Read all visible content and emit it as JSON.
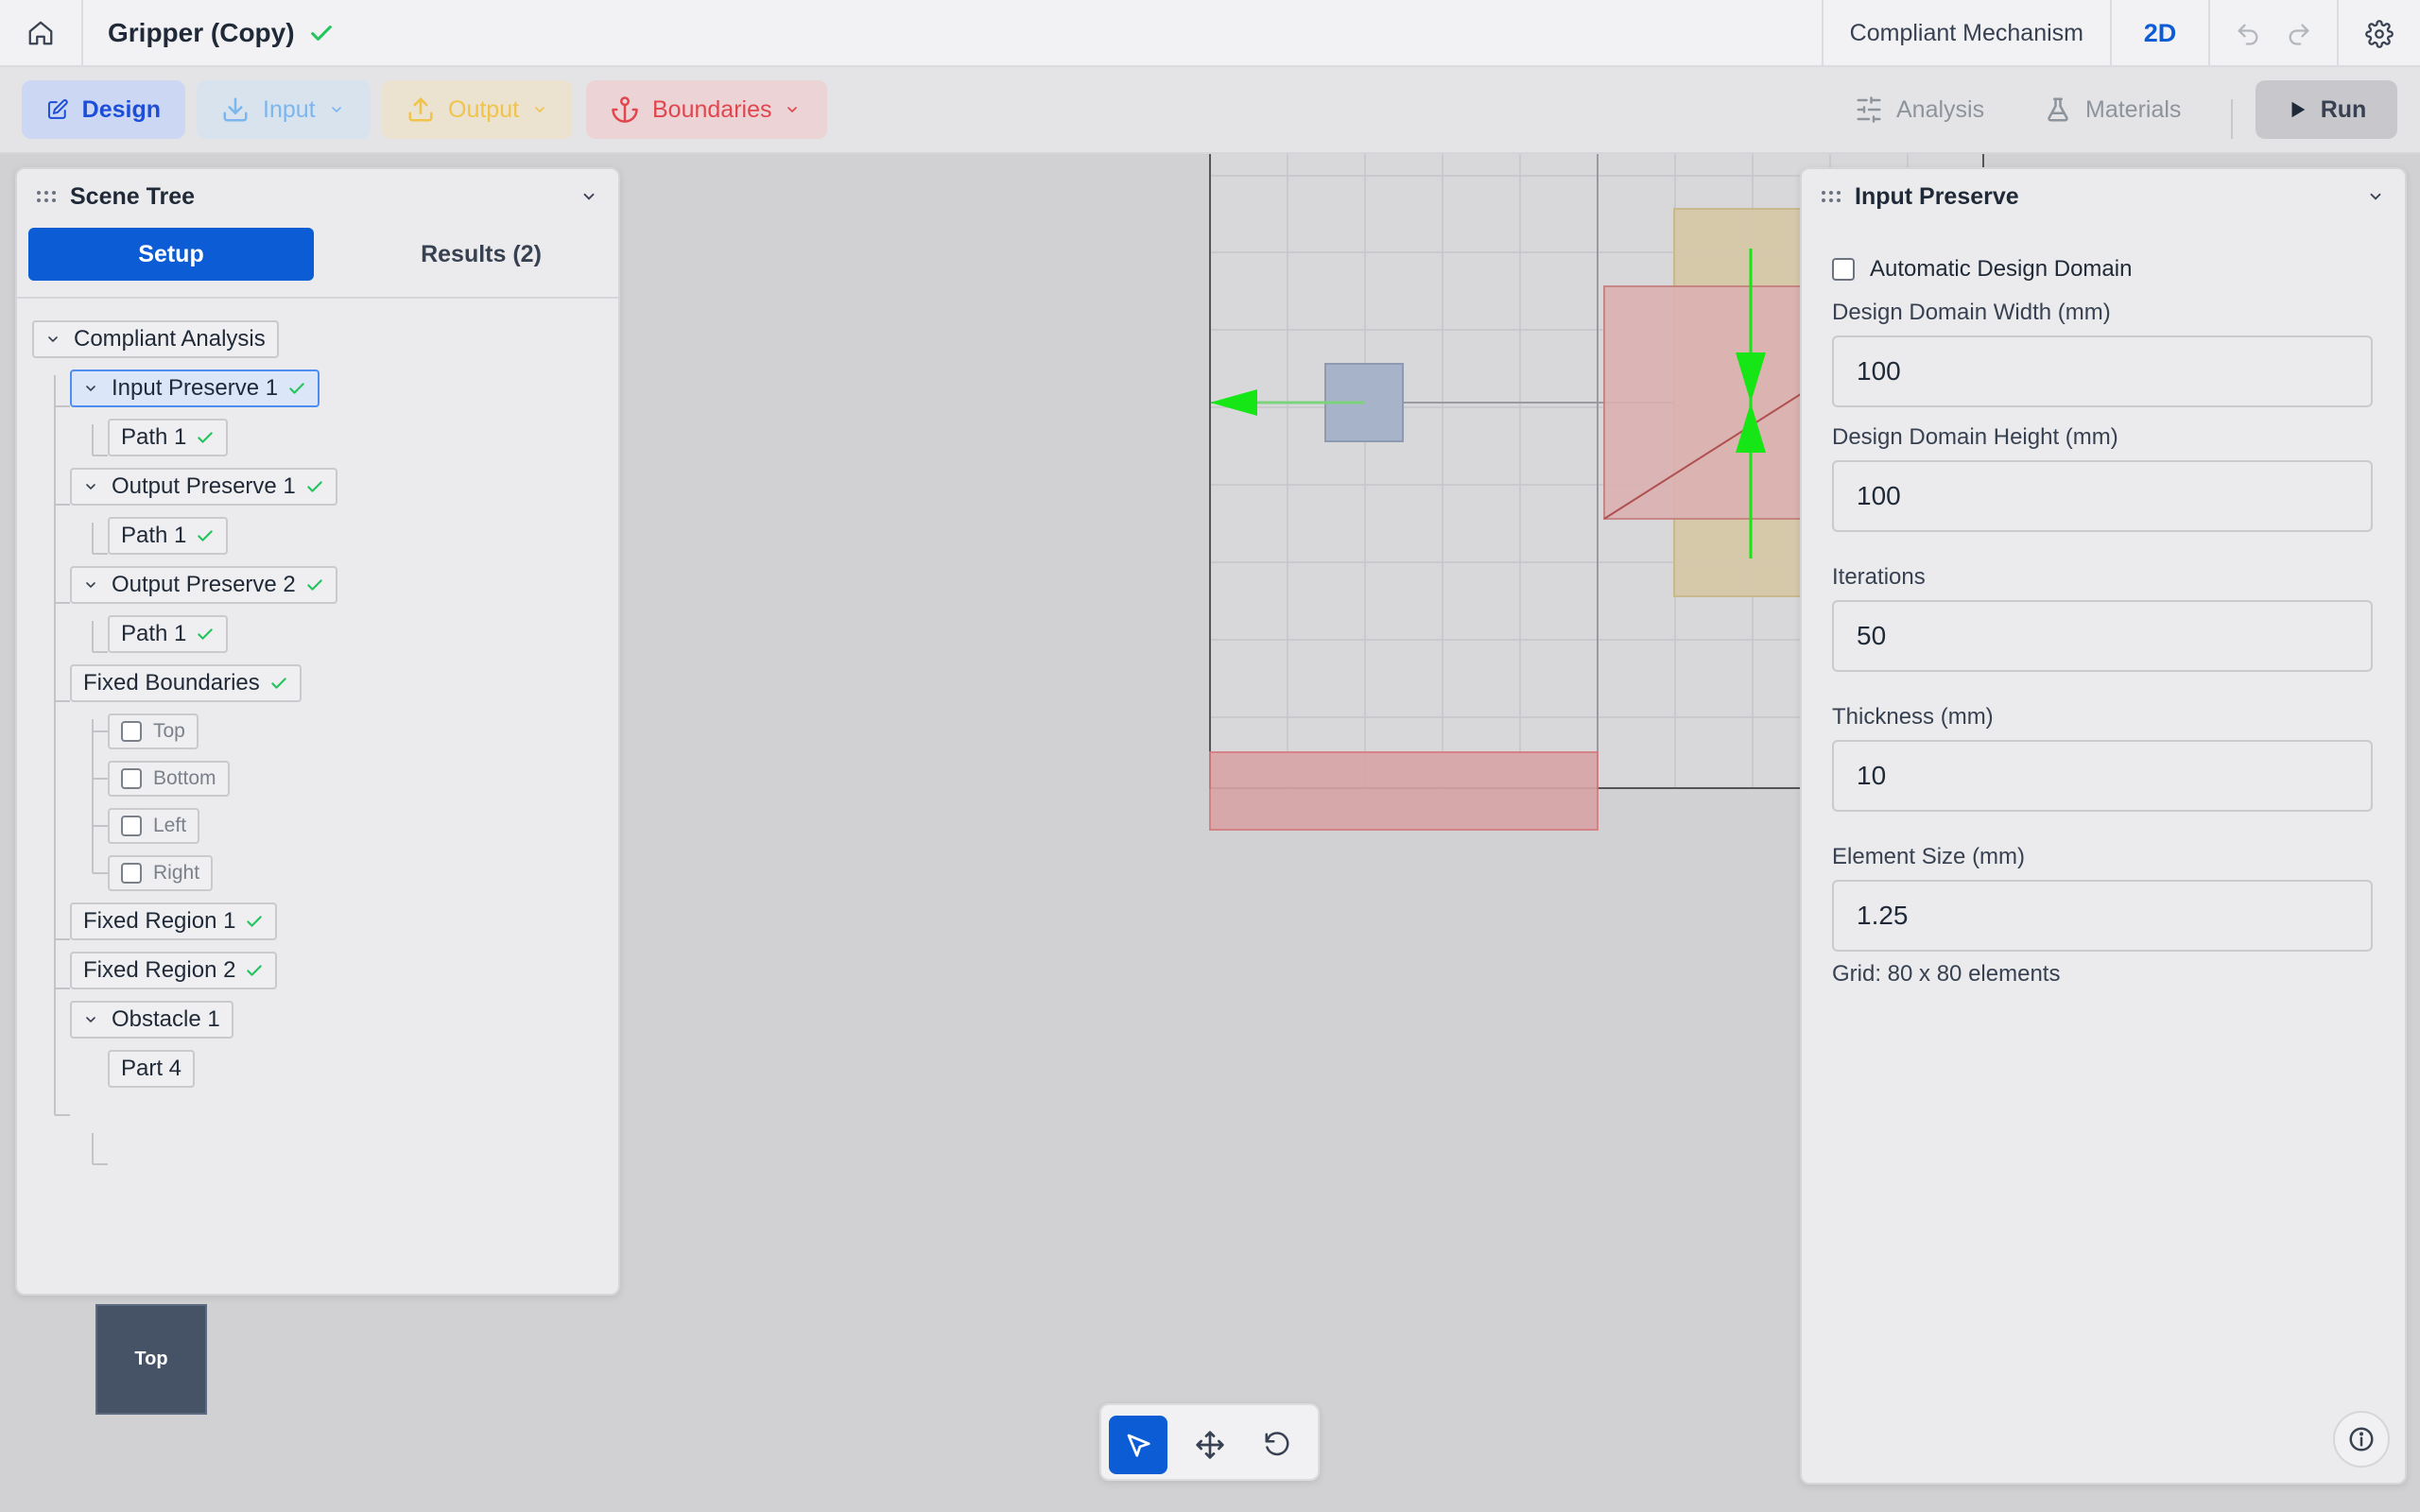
{
  "app": {
    "document_title": "Gripper (Copy)",
    "mode": "Compliant Mechanism",
    "dimension": "2D"
  },
  "toolbar": {
    "design_label": "Design",
    "input_label": "Input",
    "output_label": "Output",
    "boundaries_label": "Boundaries",
    "analysis_label": "Analysis",
    "materials_label": "Materials",
    "run_label": "Run"
  },
  "scene_tree": {
    "title": "Scene Tree",
    "tabs": {
      "setup": "Setup",
      "results": "Results (2)"
    },
    "root": "Compliant Analysis",
    "input_preserve_1": "Input Preserve 1",
    "input_path": "Path 1",
    "output_preserve_1": "Output Preserve 1",
    "output_path_1": "Path 1",
    "output_preserve_2": "Output Preserve 2",
    "output_path_2": "Path 1",
    "fixed_boundaries": "Fixed Boundaries",
    "boundary_options": [
      "Top",
      "Bottom",
      "Left",
      "Right"
    ],
    "fixed_region_1": "Fixed Region 1",
    "fixed_region_2": "Fixed Region 2",
    "obstacle_1": "Obstacle 1",
    "obstacle_part": "Part 4"
  },
  "viewcube": {
    "face": "Top"
  },
  "properties": {
    "title": "Input Preserve",
    "auto_domain_label": "Automatic Design Domain",
    "auto_domain_checked": false,
    "width_label": "Design Domain Width (mm)",
    "width_value": "100",
    "height_label": "Design Domain Height (mm)",
    "height_value": "100",
    "iterations_label": "Iterations",
    "iterations_value": "50",
    "thickness_label": "Thickness (mm)",
    "thickness_value": "10",
    "element_size_label": "Element Size (mm)",
    "element_size_value": "1.25",
    "grid_note": "Grid: 80 x 80 elements"
  },
  "colors": {
    "accent": "#0b5cd5",
    "success_check": "#22c55e",
    "force_arrow": "#16e616",
    "input_region": "#a7b3c8",
    "fixed_region": "#d7a4a6",
    "output_region": "#d6c9a8"
  }
}
